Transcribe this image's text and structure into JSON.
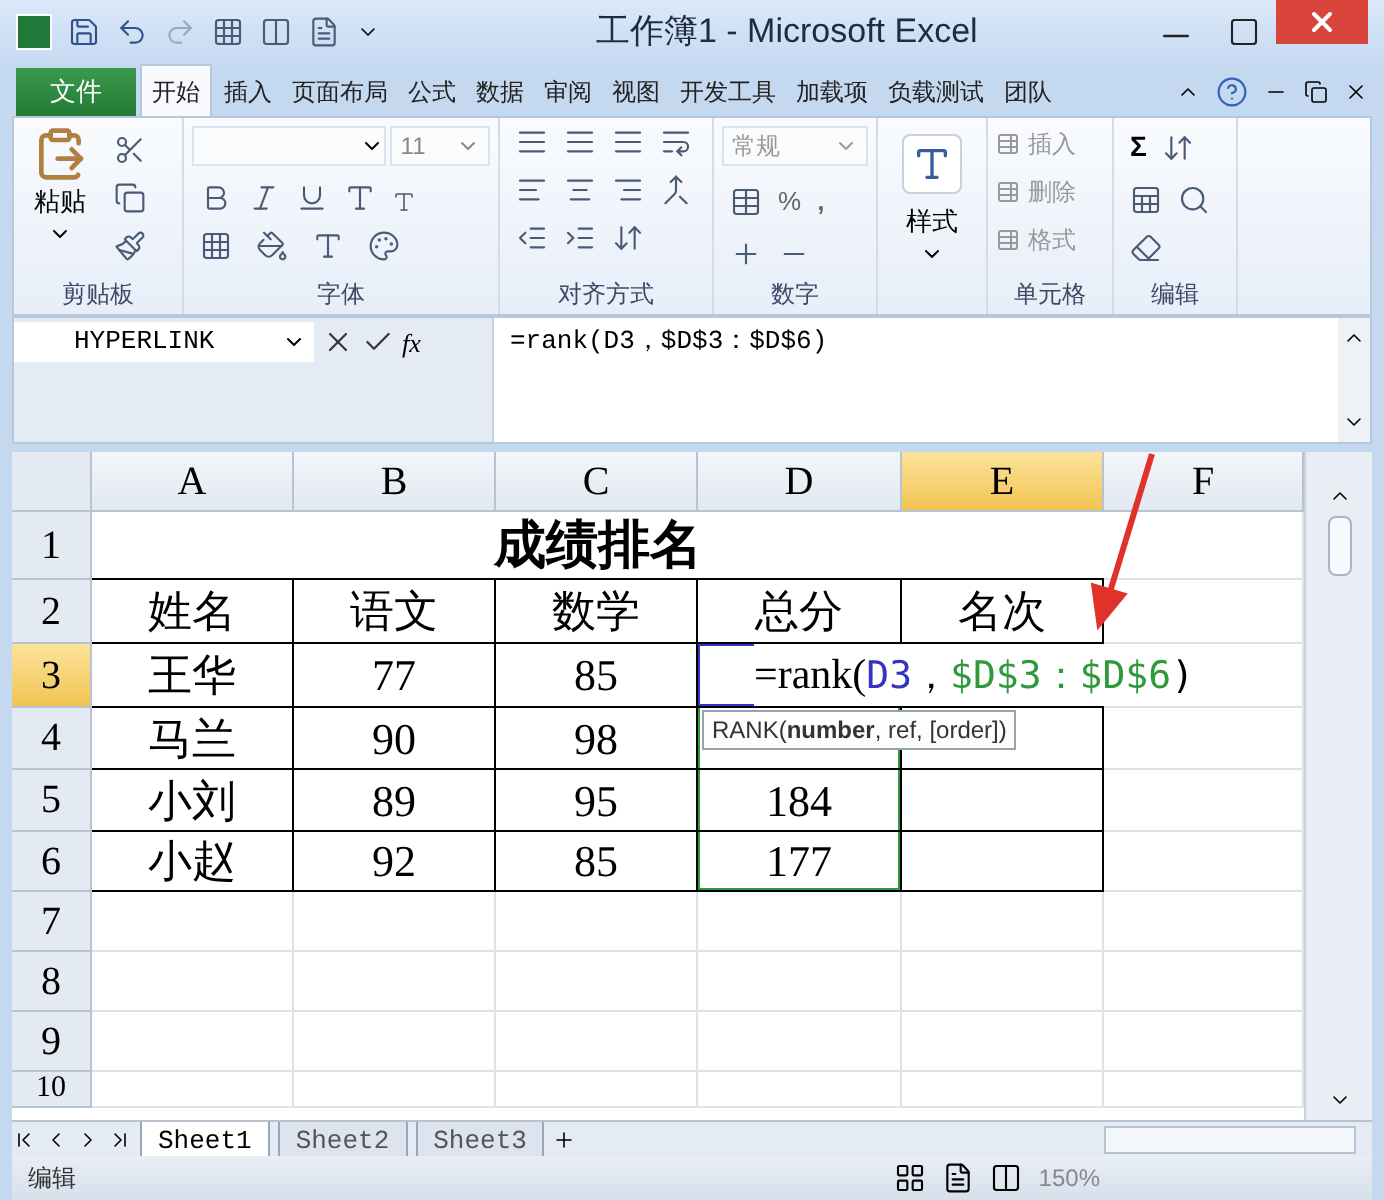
{
  "window": {
    "title": "工作簿1 - Microsoft Excel"
  },
  "file_tab": "文件",
  "tabs": [
    {
      "label": "开始",
      "selected": true
    },
    {
      "label": "插入",
      "selected": false
    },
    {
      "label": "页面布局",
      "selected": false
    },
    {
      "label": "公式",
      "selected": false
    },
    {
      "label": "数据",
      "selected": false
    },
    {
      "label": "审阅",
      "selected": false
    },
    {
      "label": "视图",
      "selected": false
    },
    {
      "label": "开发工具",
      "selected": false
    },
    {
      "label": "加载项",
      "selected": false
    },
    {
      "label": "负载测试",
      "selected": false
    },
    {
      "label": "团队",
      "selected": false
    }
  ],
  "ribbon_groups": [
    {
      "kind": "clipboard",
      "label": "剪贴板",
      "paste": "粘贴"
    },
    {
      "kind": "font",
      "label": "字体",
      "size": "11"
    },
    {
      "kind": "align",
      "label": "对齐方式"
    },
    {
      "kind": "number",
      "label": "数字",
      "format": "常规",
      "percent": "%",
      "comma": ","
    },
    {
      "kind": "styles",
      "button": "样式"
    },
    {
      "kind": "cells",
      "label": "单元格",
      "items": [
        "插入",
        "删除",
        "格式"
      ]
    },
    {
      "kind": "editing",
      "label": "编辑",
      "sum": "Σ"
    }
  ],
  "formula_bar": {
    "name_box": "HYPERLINK",
    "function_button": "fx",
    "formula": "=rank(D3，$D$3：$D$6)"
  },
  "columns": [
    {
      "label": "A",
      "selected": false
    },
    {
      "label": "B",
      "selected": false
    },
    {
      "label": "C",
      "selected": false
    },
    {
      "label": "D",
      "selected": false
    },
    {
      "label": "E",
      "selected": true
    },
    {
      "label": "F",
      "selected": false
    }
  ],
  "row_headers": [
    {
      "label": "1",
      "selected": false
    },
    {
      "label": "2",
      "selected": false
    },
    {
      "label": "3",
      "selected": true
    },
    {
      "label": "4",
      "selected": false
    },
    {
      "label": "5",
      "selected": false
    },
    {
      "label": "6",
      "selected": false
    },
    {
      "label": "7",
      "selected": false
    },
    {
      "label": "8",
      "selected": false
    },
    {
      "label": "9",
      "selected": false
    },
    {
      "label": "10",
      "selected": false
    }
  ],
  "sheet": {
    "title": "成绩排名",
    "header": [
      "姓名",
      "语文",
      "数学",
      "总分",
      "名次"
    ],
    "rows": [
      [
        "王华",
        "77",
        "85"
      ],
      [
        "马兰",
        "90",
        "98"
      ],
      [
        "小刘",
        "89",
        "95",
        "184"
      ],
      [
        "小赵",
        "92",
        "85",
        "177"
      ]
    ],
    "editing_cell": {
      "segments": [
        {
          "text": "=rank(",
          "color": "#000000"
        },
        {
          "text": "D3",
          "color": "#3434c0"
        },
        {
          "text": "，",
          "color": "#000000"
        },
        {
          "text": "$D$3：$D$6",
          "color": "#2f9a3a"
        },
        {
          "text": ")",
          "color": "#000000"
        }
      ]
    },
    "tooltip": "RANK(**number**, ref, [order])"
  },
  "sheet_tabs": [
    {
      "label": "Sheet1",
      "selected": true
    },
    {
      "label": "Sheet2",
      "selected": false
    },
    {
      "label": "Sheet3",
      "selected": false
    }
  ],
  "status_bar": {
    "mode": "编辑",
    "zoom": "150%"
  }
}
